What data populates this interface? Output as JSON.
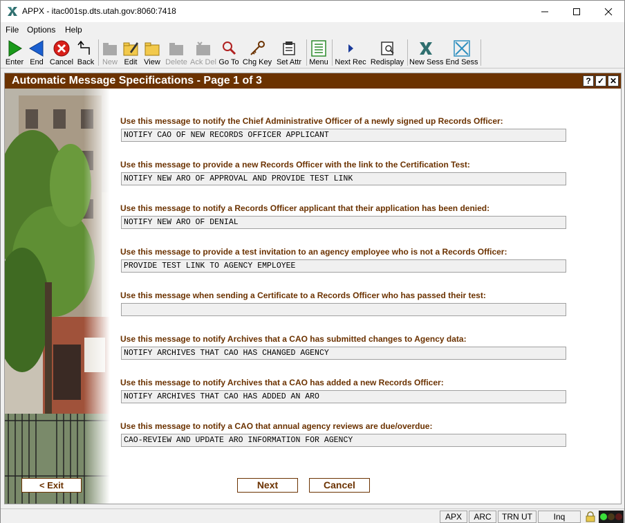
{
  "window": {
    "title": "APPX - itac001sp.dts.utah.gov:8060:7418"
  },
  "menu": [
    "File",
    "Options",
    "Help"
  ],
  "toolbar": {
    "enter": "Enter",
    "end": "End",
    "cancel": "Cancel",
    "back": "Back",
    "new": "New",
    "edit": "Edit",
    "view": "View",
    "delete": "Delete",
    "ack_del": "Ack Del",
    "go_to": "Go To",
    "chg_key": "Chg Key",
    "set_attr": "Set Attr",
    "menu": "Menu",
    "next_rec": "Next Rec",
    "redisplay": "Redisplay",
    "new_sess": "New Sess",
    "end_sess": "End Sess"
  },
  "panel": {
    "title": "Automatic Message Specifications - Page 1 of 3",
    "help": "?",
    "ok": "✓",
    "close": "✕"
  },
  "questions": [
    {
      "label": "Use this message to notify the Chief Administrative Officer of a newly signed up Records Officer:",
      "value": "NOTIFY CAO OF NEW RECORDS OFFICER APPLICANT"
    },
    {
      "label": "Use this message to provide a new Records Officer with the link to the Certification Test:",
      "value": "NOTIFY NEW ARO OF APPROVAL AND PROVIDE TEST LINK"
    },
    {
      "label": "Use this message to notify a Records Officer applicant that their application has been denied:",
      "value": "NOTIFY NEW ARO OF DENIAL"
    },
    {
      "label": "Use this message to provide a test invitation to an agency employee who is not a Records Officer:",
      "value": "PROVIDE TEST LINK TO AGENCY EMPLOYEE"
    },
    {
      "label": "Use this message when sending a Certificate to a Records Officer who has passed their test:",
      "value": ""
    },
    {
      "label": "Use this message to notify Archives that a CAO has submitted changes to Agency data:",
      "value": "NOTIFY ARCHIVES THAT CAO HAS CHANGED AGENCY"
    },
    {
      "label": "Use this message to notify Archives that a CAO has added a new Records Officer:",
      "value": "NOTIFY ARCHIVES THAT CAO HAS ADDED AN ARO"
    },
    {
      "label": "Use this message to notify a CAO that annual agency reviews are due/overdue:",
      "value": "CAO-REVIEW AND UPDATE ARO INFORMATION FOR AGENCY"
    }
  ],
  "buttons": {
    "exit": "< Exit",
    "next": "Next",
    "cancel": "Cancel"
  },
  "status": {
    "apx": "APX",
    "arc": "ARC",
    "trn": "TRN UT",
    "mode": "Inq"
  },
  "colors": {
    "accent": "#6b3200",
    "header_bg": "#6b3200",
    "field_bg": "#f0f0f0"
  }
}
